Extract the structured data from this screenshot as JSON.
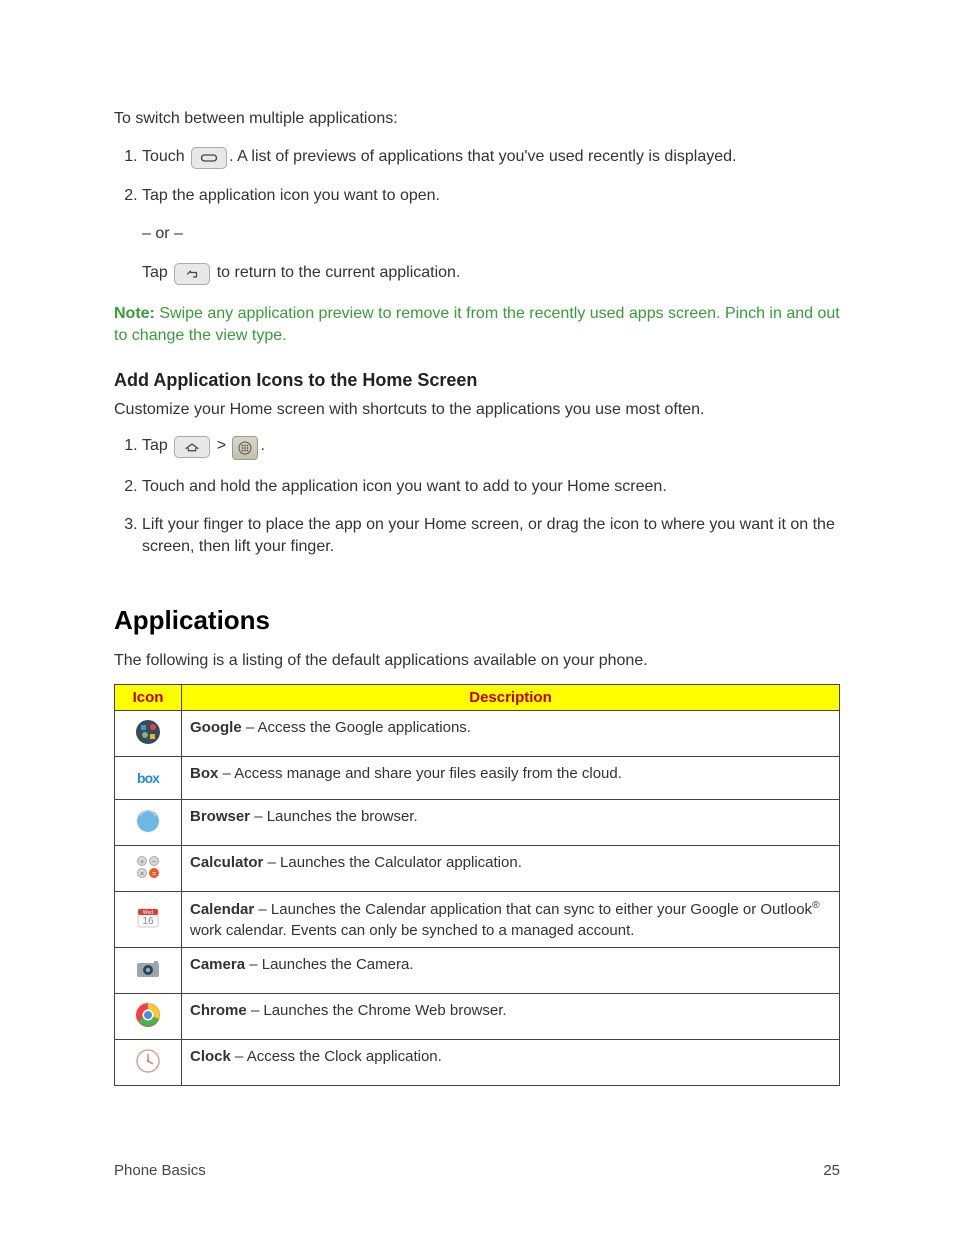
{
  "section_switch": {
    "intro": "To switch between multiple applications:",
    "step1_pre": "Touch ",
    "step1_post": ". A list of previews of applications that you've used recently is displayed.",
    "step2": "Tap the application icon you want to open.",
    "or": "– or –",
    "step2b_pre": "Tap ",
    "step2b_post": " to return to the current application."
  },
  "note": {
    "label": "Note:",
    "text": " Swipe any application preview to remove it from the recently used apps screen. Pinch in and out to change the view type."
  },
  "add_icons": {
    "heading": "Add Application Icons to the Home Screen",
    "desc": "Customize your Home screen with shortcuts to the applications you use most often.",
    "step1_pre": "Tap ",
    "step1_mid": " > ",
    "step1_post": ".",
    "step2": "Touch and hold the application icon you want to add to your Home screen.",
    "step3": "Lift your finger to place the app on your Home screen, or drag the icon to where you want it on the screen, then lift your finger."
  },
  "applications": {
    "heading": "Applications",
    "desc": "The following is a listing of the default applications available on your phone.",
    "th_icon": "Icon",
    "th_desc": "Description",
    "items": [
      {
        "icon": "google",
        "name": "Google",
        "desc": " – Access the Google applications."
      },
      {
        "icon": "box",
        "name": "Box",
        "desc": " – Access manage and share your files easily from the cloud."
      },
      {
        "icon": "browser",
        "name": "Browser",
        "desc": " – Launches the browser."
      },
      {
        "icon": "calculator",
        "name": "Calculator",
        "desc": " – Launches the Calculator application."
      },
      {
        "icon": "calendar",
        "name": "Calendar",
        "desc": " – Launches the Calendar application that can sync to either your Google or Outlook",
        "desc_sup": "®",
        "desc2": " work calendar. Events can only be synched to a managed account."
      },
      {
        "icon": "camera",
        "name": "Camera",
        "desc": " – Launches the Camera."
      },
      {
        "icon": "chrome",
        "name": "Chrome",
        "desc": " – Launches the Chrome Web browser."
      },
      {
        "icon": "clock",
        "name": "Clock",
        "desc": " – Access the Clock application."
      }
    ]
  },
  "footer": {
    "left": "Phone Basics",
    "right": "25"
  }
}
